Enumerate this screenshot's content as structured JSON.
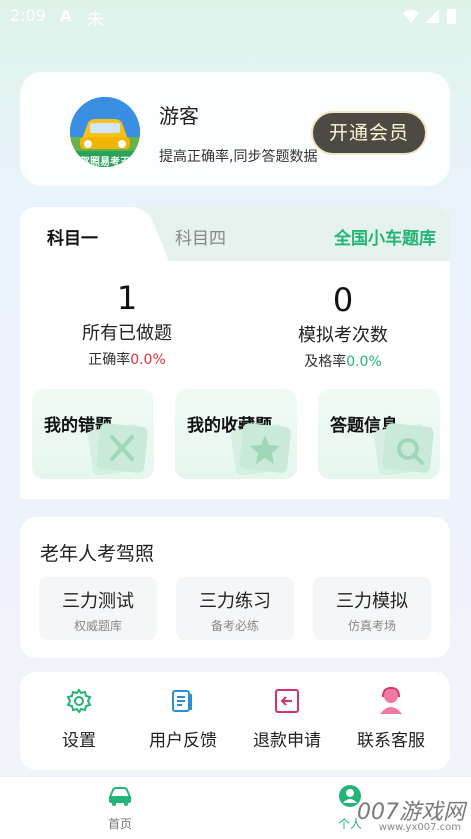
{
  "status_bar": {
    "time": "2:09",
    "icon_a": "A",
    "icon_b": "未",
    "wifi_icon": "wifi-icon",
    "signal_icon": "signal-icon",
    "battery_icon": "battery-icon"
  },
  "profile": {
    "name": "游客",
    "subtitle": "提高正确率,同步答题数据",
    "vip_button": "开通会员",
    "avatar_text": "驾照易考王"
  },
  "subject_tabs": {
    "tab1": "科目一",
    "tab2": "科目四",
    "bank": "全国小车题库"
  },
  "stats": {
    "done": {
      "value": "1",
      "label": "所有已做题",
      "rate_label": "正确率",
      "rate_value": "0.0%"
    },
    "exam": {
      "value": "0",
      "label": "模拟考次数",
      "rate_label": "及格率",
      "rate_value": "0.0%"
    }
  },
  "features": [
    {
      "label": "我的错题",
      "icon": "cross-icon"
    },
    {
      "label": "我的收藏题",
      "icon": "star-icon"
    },
    {
      "label": "答题信息",
      "icon": "search-icon"
    }
  ],
  "elder": {
    "title": "老年人考驾照",
    "items": [
      {
        "title": "三力测试",
        "sub": "权威题库"
      },
      {
        "title": "三力练习",
        "sub": "备考必练"
      },
      {
        "title": "三力模拟",
        "sub": "仿真考场"
      }
    ]
  },
  "menu": [
    {
      "label": "设置",
      "icon": "gear-icon"
    },
    {
      "label": "用户反馈",
      "icon": "feedback-icon"
    },
    {
      "label": "退款申请",
      "icon": "refund-icon"
    },
    {
      "label": "联系客服",
      "icon": "service-icon"
    }
  ],
  "bottom_nav": [
    {
      "label": "首页",
      "icon": "car-icon"
    },
    {
      "label": "个人",
      "icon": "user-icon"
    }
  ],
  "watermark": {
    "main": "007游戏网",
    "sub": "www.yx007.com"
  },
  "colors": {
    "accent": "#24b476",
    "red": "#e0303a",
    "vip_bg": "#4d4a44",
    "refund": "#d6336c"
  }
}
